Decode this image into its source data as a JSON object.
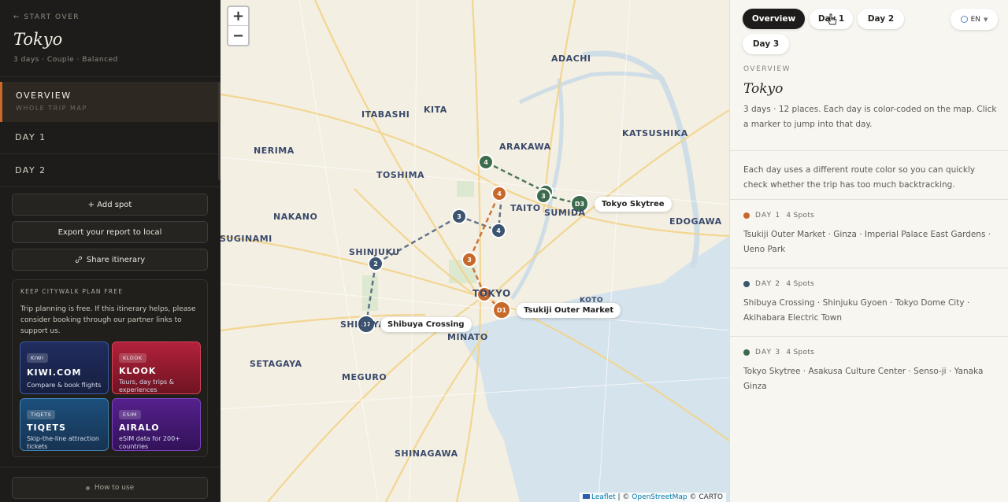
{
  "sidebar": {
    "start_over": "← START OVER",
    "city": "Tokyo",
    "meta": "3 days · Couple · Balanced",
    "nav": [
      {
        "label": "OVERVIEW",
        "sub": "WHOLE TRIP MAP"
      },
      {
        "label": "DAY 1"
      },
      {
        "label": "DAY 2"
      }
    ],
    "buttons": {
      "add_spot": "+ Add spot",
      "export": "Export your report to local",
      "share": "Share itinerary"
    },
    "promo": {
      "title": "KEEP CITYWALK PLAN FREE",
      "text": "Trip planning is free. If this itinerary helps, please consider booking through our partner links to support us.",
      "partners": [
        {
          "tag": "KIWI",
          "name": "KIWI.COM",
          "desc": "Compare & book flights"
        },
        {
          "tag": "KLOOK",
          "name": "KLOOK",
          "desc": "Tours, day trips & experiences"
        },
        {
          "tag": "TIQETS",
          "name": "TIQETS",
          "desc": "Skip-the-line attraction tickets"
        },
        {
          "tag": "ESIM",
          "name": "AIRALO",
          "desc": "eSIM data for 200+ countries"
        }
      ]
    },
    "how_to": "How to use"
  },
  "map": {
    "zoom_in": "+",
    "zoom_out": "−",
    "districts": [
      "ADACHI",
      "KITA",
      "ITABASHI",
      "ARAKAWA",
      "KATSUSHIKA",
      "NERIMA",
      "TOSHIMA",
      "TAITO",
      "SUMIDA",
      "NAKANO",
      "EDOGAWA",
      "SUGINAMI",
      "SHINJUKU",
      "TOKYO",
      "KOTO",
      "SHIBUYA",
      "MINATO",
      "SETAGAYA",
      "MEGURO",
      "SHINAGAWA"
    ],
    "route_colors": {
      "day1": "#c8692a",
      "day2": "#3b5470",
      "day3": "#3d6b4d"
    },
    "markers": [
      {
        "day": 1,
        "label": "D1"
      },
      {
        "day": 1,
        "label": "2"
      },
      {
        "day": 1,
        "label": "3"
      },
      {
        "day": 1,
        "label": "4"
      },
      {
        "day": 2,
        "label": "D2"
      },
      {
        "day": 2,
        "label": "2"
      },
      {
        "day": 2,
        "label": "3"
      },
      {
        "day": 2,
        "label": "4"
      },
      {
        "day": 3,
        "label": "D3"
      },
      {
        "day": 3,
        "label": "2"
      },
      {
        "day": 3,
        "label": "3"
      },
      {
        "day": 3,
        "label": "4"
      }
    ],
    "start_labels": [
      "Tokyo Skytree",
      "Tsukiji Outer Market",
      "Shibuya Crossing"
    ],
    "attribution": {
      "leaflet": "Leaflet",
      "sep": " | © ",
      "osm": "OpenStreetMap",
      "carto": " © CARTO"
    }
  },
  "panel": {
    "tabs": [
      "Overview",
      "Day 1",
      "Day 2",
      "Day 3"
    ],
    "lang": "EN",
    "eyebrow": "OVERVIEW",
    "title": "Tokyo",
    "summary": "3 days · 12 places. Each day is color-coded on the map. Click a marker to jump into that day.",
    "note": "Each day uses a different route color so you can quickly check whether the trip has too much backtracking.",
    "days": [
      {
        "label": "DAY 1",
        "count": "4 Spots",
        "color": "#c8692a",
        "places": "Tsukiji Outer Market · Ginza · Imperial Palace East Gardens · Ueno Park"
      },
      {
        "label": "DAY 2",
        "count": "4 Spots",
        "color": "#3b5470",
        "places": "Shibuya Crossing · Shinjuku Gyoen · Tokyo Dome City · Akihabara Electric Town"
      },
      {
        "label": "DAY 3",
        "count": "4 Spots",
        "color": "#3d6b4d",
        "places": "Tokyo Skytree · Asakusa Culture Center · Senso-ji · Yanaka Ginza"
      }
    ]
  }
}
